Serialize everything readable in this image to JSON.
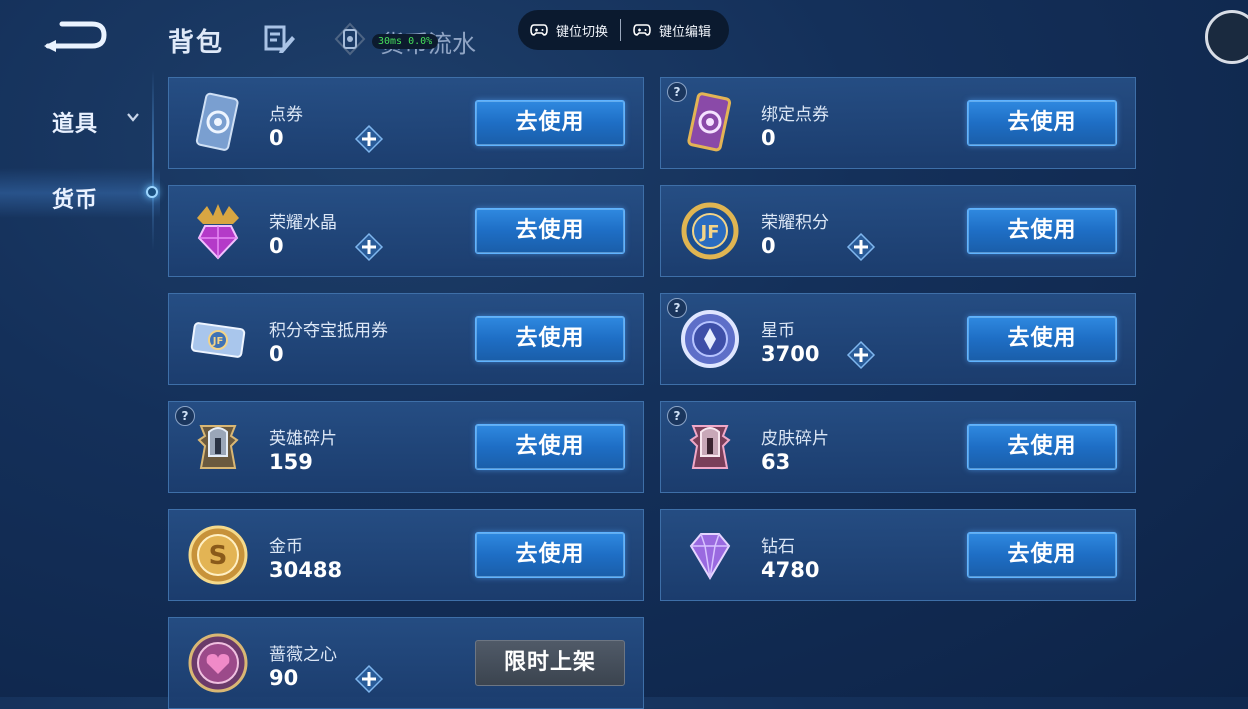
{
  "header": {
    "title": "背包",
    "tab_label": "货币流水",
    "perf_text": "30ms  0.0%"
  },
  "keymap_bar": {
    "switch_label": "键位切换",
    "edit_label": "键位编辑"
  },
  "sidebar": {
    "items": [
      {
        "label": "道具"
      },
      {
        "label": "货币"
      }
    ]
  },
  "currencies": [
    {
      "name": "点券",
      "value": "0",
      "button": "去使用",
      "icon": "coupon-ticket-icon"
    },
    {
      "name": "绑定点券",
      "value": "0",
      "button": "去使用",
      "icon": "bound-coupon-icon"
    },
    {
      "name": "荣耀水晶",
      "value": "0",
      "button": "去使用",
      "icon": "glory-crystal-icon"
    },
    {
      "name": "荣耀积分",
      "value": "0",
      "button": "去使用",
      "icon": "glory-points-icon"
    },
    {
      "name": "积分夺宝抵用券",
      "value": "0",
      "button": "去使用",
      "icon": "treasure-voucher-icon"
    },
    {
      "name": "星币",
      "value": "3700",
      "button": "去使用",
      "icon": "star-coin-icon"
    },
    {
      "name": "英雄碎片",
      "value": "159",
      "button": "去使用",
      "icon": "hero-fragment-icon"
    },
    {
      "name": "皮肤碎片",
      "value": "63",
      "button": "去使用",
      "icon": "skin-fragment-icon"
    },
    {
      "name": "金币",
      "value": "30488",
      "button": "去使用",
      "icon": "gold-coin-icon"
    },
    {
      "name": "钻石",
      "value": "4780",
      "button": "去使用",
      "icon": "diamond-icon"
    },
    {
      "name": "蔷薇之心",
      "value": "90",
      "button": "限时上架",
      "icon": "rose-heart-icon"
    }
  ],
  "help_mark": "?",
  "colors": {
    "accent_blue": "#2f89e0",
    "card_border": "#3e6fa8",
    "limited_gray": "#505a68",
    "perf_green": "#46e05b"
  }
}
